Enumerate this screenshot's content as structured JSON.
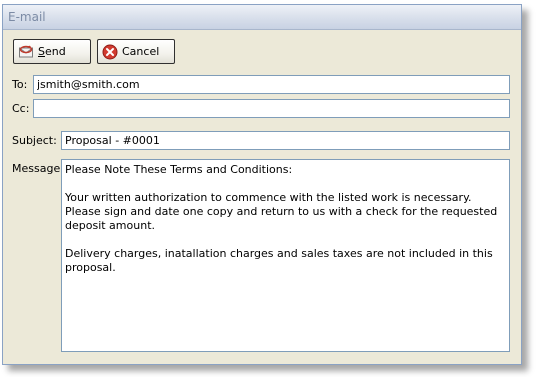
{
  "window": {
    "title": "E-mail"
  },
  "toolbar": {
    "send_label": "Send",
    "send_accesskey": "S",
    "cancel_label": "Cancel"
  },
  "form": {
    "to_label": "To:",
    "to_value": "jsmith@smith.com",
    "cc_label": "Cc:",
    "cc_value": "",
    "subject_label": "Subject:",
    "subject_value": "Proposal - #0001",
    "message_label": "Message:",
    "message_value": "Please Note These Terms and Conditions:\n\nYour written authorization to commence with the listed work is necessary.  Please sign and date one copy and return to us with a check for the requested deposit amount.\n\nDelivery charges, inatallation charges and sales taxes are not included in this proposal."
  },
  "icons": {
    "send": "send-mail-icon",
    "cancel": "cancel-x-icon"
  },
  "colors": {
    "window_bg": "#ece9d8",
    "field_border": "#7f9db9",
    "title_text": "#7c8ba5",
    "cancel_icon": "#c8322a"
  }
}
